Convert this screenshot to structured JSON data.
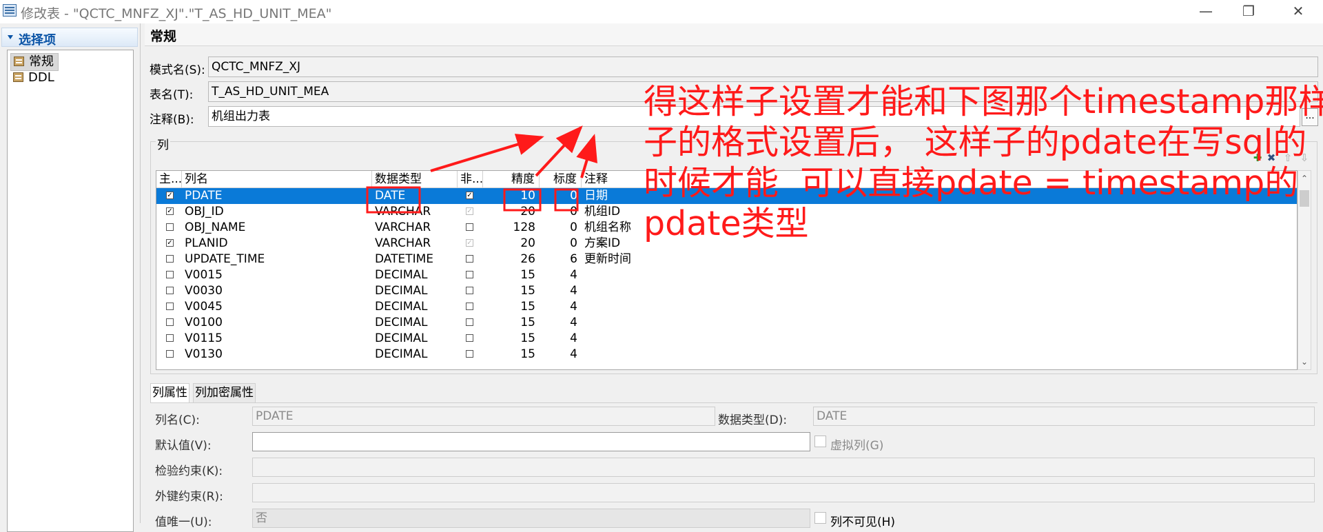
{
  "window": {
    "title": "修改表 - \"QCTC_MNFZ_XJ\".\"T_AS_HD_UNIT_MEA\"",
    "controls": [
      "—",
      "❐",
      "✕"
    ]
  },
  "nav": {
    "header": "选择项",
    "items": [
      "常规",
      "DDL"
    ]
  },
  "section_title": "常规",
  "form": {
    "schema_label": "模式名(S):",
    "schema_value": "QCTC_MNFZ_XJ",
    "table_label": "表名(T):",
    "table_value": "T_AS_HD_UNIT_MEA",
    "comment_label": "注释(B):",
    "comment_value": "机组出力表",
    "ellipsis": "..."
  },
  "columns_group": {
    "title": "列",
    "headers": [
      "主...",
      "列名",
      "数据类型",
      "非...",
      "精度",
      "标度",
      "注释"
    ],
    "rows": [
      {
        "pk": true,
        "name": "PDATE",
        "type": "DATE",
        "nn": true,
        "nn_disabled": false,
        "precision": "10",
        "scale": "0",
        "comment": "日期"
      },
      {
        "pk": true,
        "name": "OBJ_ID",
        "type": "VARCHAR",
        "nn": true,
        "nn_disabled": true,
        "precision": "20",
        "scale": "0",
        "comment": "机组ID"
      },
      {
        "pk": false,
        "name": "OBJ_NAME",
        "type": "VARCHAR",
        "nn": false,
        "nn_disabled": false,
        "precision": "128",
        "scale": "0",
        "comment": "机组名称"
      },
      {
        "pk": true,
        "name": "PLANID",
        "type": "VARCHAR",
        "nn": true,
        "nn_disabled": true,
        "precision": "20",
        "scale": "0",
        "comment": "方案ID"
      },
      {
        "pk": false,
        "name": "UPDATE_TIME",
        "type": "DATETIME",
        "nn": false,
        "nn_disabled": false,
        "precision": "26",
        "scale": "6",
        "comment": "更新时间"
      },
      {
        "pk": false,
        "name": "V0015",
        "type": "DECIMAL",
        "nn": false,
        "nn_disabled": false,
        "precision": "15",
        "scale": "4",
        "comment": ""
      },
      {
        "pk": false,
        "name": "V0030",
        "type": "DECIMAL",
        "nn": false,
        "nn_disabled": false,
        "precision": "15",
        "scale": "4",
        "comment": ""
      },
      {
        "pk": false,
        "name": "V0045",
        "type": "DECIMAL",
        "nn": false,
        "nn_disabled": false,
        "precision": "15",
        "scale": "4",
        "comment": ""
      },
      {
        "pk": false,
        "name": "V0100",
        "type": "DECIMAL",
        "nn": false,
        "nn_disabled": false,
        "precision": "15",
        "scale": "4",
        "comment": ""
      },
      {
        "pk": false,
        "name": "V0115",
        "type": "DECIMAL",
        "nn": false,
        "nn_disabled": false,
        "precision": "15",
        "scale": "4",
        "comment": ""
      },
      {
        "pk": false,
        "name": "V0130",
        "type": "DECIMAL",
        "nn": false,
        "nn_disabled": false,
        "precision": "15",
        "scale": "4",
        "comment": ""
      }
    ],
    "selected_row": 0
  },
  "tabs": [
    "列属性",
    "列加密属性"
  ],
  "props": {
    "colname_label": "列名(C):",
    "colname_value": "PDATE",
    "dtype_label": "数据类型(D):",
    "dtype_value": "DATE",
    "default_label": "默认值(V):",
    "default_value": "",
    "virtual_label": "虚拟列(G)",
    "check_label": "检验约束(K):",
    "fk_label": "外键约束(R):",
    "unique_label": "值唯一(U):",
    "unique_value": "否",
    "invisible_label": "列不可见(H)"
  },
  "annotation": {
    "lines": [
      "得这样子设置才能和下图那个timestamp那样",
      "子的格式设置后， 这样子的pdate在写sql的",
      "时候才能  可以直接pdate = timestamp的",
      "pdate类型"
    ],
    "color": "#ff1a1a"
  },
  "colors": {
    "selection": "#0a7ad8",
    "accent": "#0b54a6"
  }
}
